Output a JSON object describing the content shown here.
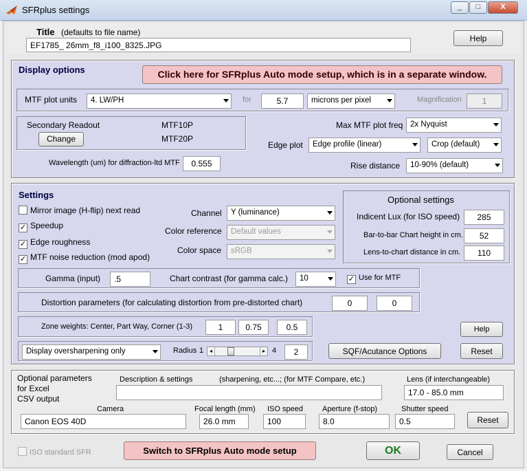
{
  "window": {
    "title": "SFRplus settings",
    "icon": "matlab-logo-icon",
    "controls": [
      "_",
      "□",
      "X"
    ]
  },
  "title_section": {
    "label": "Title",
    "hint": "(defaults to file name)",
    "value": "EF1785_ 26mm_f8_i100_8325.JPG",
    "help": "Help"
  },
  "display_options": {
    "heading": "Display options",
    "auto_mode_button": "Click here for SFRplus Auto mode setup, which is in a separate window.",
    "mtf_units_label": "MTF plot units",
    "mtf_units_value": "4. LW/PH",
    "for_label": "for",
    "pixel_value": "5.7",
    "pixel_unit": "microns per pixel",
    "magnification_label": "Magnification",
    "magnification_value": "1",
    "secondary_readout_label": "Secondary Readout",
    "mtf10p": "MTF10P",
    "mtf20p": "MTF20P",
    "change_button": "Change",
    "max_mtf_label": "Max MTF plot freq",
    "max_mtf_value": "2x Nyquist",
    "edge_plot_label": "Edge plot",
    "edge_plot_value": "Edge profile (linear)",
    "crop_value": "Crop (default)",
    "wavelength_label": "Wavelength (um) for diffraction-ltd MTF",
    "wavelength_value": "0.555",
    "rise_label": "Rise distance",
    "rise_value": "10-90% (default)"
  },
  "settings": {
    "heading": "Settings",
    "mirror": {
      "label": "Mirror image (H-flip) next read",
      "checked": false
    },
    "speedup": {
      "label": "Speedup",
      "checked": true
    },
    "edge_roughness": {
      "label": "Edge roughness",
      "checked": true
    },
    "noise_reduction": {
      "label": "MTF noise reduction (mod  apod)",
      "checked": true
    },
    "channel_label": "Channel",
    "channel_value": "Y (luminance)",
    "color_ref_label": "Color reference",
    "color_ref_value": "Default values",
    "color_space_label": "Color space",
    "color_space_value": "sRGB",
    "optional": {
      "heading": "Optional settings",
      "lux_label": "Indicent Lux (for ISO speed)",
      "lux_value": "285",
      "bar_label": "Bar-to-bar Chart height in cm.",
      "bar_value": "52",
      "lens_label": "Lens-to-chart distance in cm.",
      "lens_value": "110"
    },
    "gamma_label": "Gamma (input)",
    "gamma_value": ".5",
    "contrast_label": "Chart contrast (for gamma calc.)",
    "contrast_value": "10",
    "use_for_mtf": {
      "label": "Use for MTF",
      "checked": true
    },
    "distortion_label": "Distortion parameters (for calculating distortion from pre-distorted chart)",
    "distortion_1": "0",
    "distortion_2": "0",
    "zone_label": "Zone weights:  Center, Part Way, Corner (1-3)",
    "zone_1": "1",
    "zone_2": "0.75",
    "zone_3": "0.5",
    "help2": "Help",
    "oversharpen_value": "Display oversharpening only",
    "radius_label": "Radius",
    "radius_min": "1",
    "radius_max": "4",
    "radius_value": "2",
    "radius_slider_level": 0.33,
    "sqf_button": "SQF/Acutance Options",
    "reset1": "Reset"
  },
  "optional_params": {
    "heading_line1": "Optional parameters",
    "heading_line2": "for Excel",
    "heading_line3": "CSV output",
    "description_label": "Description & settings",
    "description_hint": "(sharpening, etc...; (for MTF Compare, etc.)",
    "description_value": "",
    "lens_label": "Lens (if interchangeable)",
    "lens_value": "17.0 - 85.0 mm",
    "camera_label": "Camera",
    "camera_value": "Canon EOS 40D",
    "focal_label": "Focal length (mm)",
    "focal_value": "26.0 mm",
    "iso_label": "ISO speed",
    "iso_value": "100",
    "aperture_label": "Aperture (f-stop)",
    "aperture_value": "8.0",
    "shutter_label": "Shutter speed",
    "shutter_value": "0.5",
    "reset2": "Reset"
  },
  "footer": {
    "iso_sfr": {
      "label": "ISO standard SFR",
      "checked": false
    },
    "switch_button": "Switch to SFRplus Auto mode setup",
    "ok": "OK",
    "cancel": "Cancel"
  },
  "colors": {
    "blue_panel": "#d7d7ee",
    "auto_button": "#f4c4c4",
    "ok_green": "#1a7a1a",
    "heading_navy": "#000040"
  }
}
